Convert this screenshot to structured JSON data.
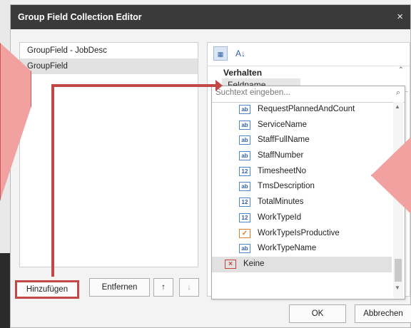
{
  "dialog": {
    "title": "Group Field Collection Editor",
    "close_glyph": "×"
  },
  "left_list": {
    "items": [
      {
        "label": "GroupField - JobDesc",
        "selected": false
      },
      {
        "label": "GroupField",
        "selected": true
      }
    ]
  },
  "buttons": {
    "add": "Hinzufügen",
    "remove": "Entfernen",
    "up_icon": "arrow-up-icon",
    "down_icon": "arrow-down-icon",
    "ok": "OK",
    "cancel": "Abbrechen"
  },
  "property_grid": {
    "toolbar": {
      "categorized_icon": "categorized-icon",
      "alphabetical_icon": "sort-az-icon",
      "az_label": "A↓"
    },
    "category": "Verhalten",
    "property_name": "Feldname",
    "property_value": ""
  },
  "dropdown": {
    "search_placeholder": "Suchtext eingeben...",
    "items": [
      {
        "type": "ab",
        "name": "RequestPlannedAndCount"
      },
      {
        "type": "ab",
        "name": "ServiceName"
      },
      {
        "type": "ab",
        "name": "StaffFullName"
      },
      {
        "type": "ab",
        "name": "StaffNumber"
      },
      {
        "type": "12",
        "name": "TimesheetNo"
      },
      {
        "type": "ab",
        "name": "TmsDescription"
      },
      {
        "type": "12",
        "name": "TotalMinutes"
      },
      {
        "type": "12",
        "name": "WorkTypeId"
      },
      {
        "type": "✓",
        "name": "WorkTypeIsProductive"
      },
      {
        "type": "ab",
        "name": "WorkTypeName"
      }
    ],
    "none_item": {
      "type": "×",
      "name": "Keine"
    }
  },
  "colors": {
    "highlight": "#c24848",
    "arrow_fill": "#f2a1a1",
    "titlebar": "#3a3a3a"
  }
}
